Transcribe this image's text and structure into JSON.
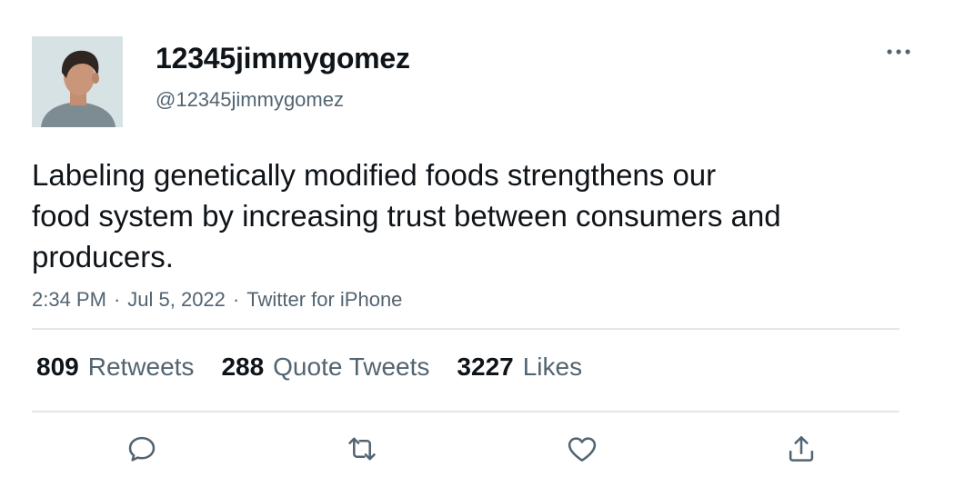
{
  "user": {
    "display_name": "12345jimmygomez",
    "handle": "@12345jimmygomez",
    "avatar_icon": "profile-photo"
  },
  "tweet": {
    "text_lines": [
      "Labeling genetically modified foods strengthens our",
      "food system by increasing trust between consumers and",
      "producers."
    ]
  },
  "meta": {
    "time": "2:34 PM",
    "sep1": "·",
    "date": "Jul 5, 2022",
    "sep2": "·",
    "source": "Twitter for iPhone"
  },
  "stats": {
    "retweets": {
      "count": "809",
      "label": "Retweets"
    },
    "quotes": {
      "count": "288",
      "label": "Quote Tweets"
    },
    "likes": {
      "count": "3227",
      "label": "Likes"
    }
  },
  "icons": {
    "more": "more-dots-icon",
    "reply": "reply-icon",
    "retweet": "retweet-icon",
    "like": "heart-icon",
    "share": "share-icon"
  },
  "colors": {
    "text": "#0f1419",
    "secondary": "#536471",
    "divider": "#e4e6e8"
  }
}
